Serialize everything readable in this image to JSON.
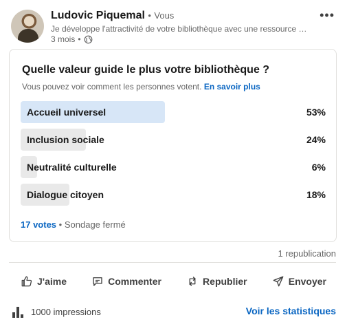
{
  "author": {
    "name": "Ludovic Piquemal",
    "separator": "•",
    "relation": "Vous",
    "headline": "Je développe l'attractivité de votre bibliothèque avec une ressource …",
    "time": "3 mois",
    "time_separator": "•",
    "visibility_icon": "globe-icon"
  },
  "menu_icon": "more-horizontal-icon",
  "poll": {
    "question": "Quelle valeur guide le plus votre bibliothèque ?",
    "visibility_text": "Vous pouvez voir comment les personnes votent.",
    "learn_more": "En savoir plus",
    "options": [
      {
        "label": "Accueil universel",
        "percent_text": "53%",
        "percent": 53,
        "selected": true
      },
      {
        "label": "Inclusion sociale",
        "percent_text": "24%",
        "percent": 24,
        "selected": false
      },
      {
        "label": "Neutralité culturelle",
        "percent_text": "6%",
        "percent": 6,
        "selected": false
      },
      {
        "label": "Dialogue citoyen",
        "percent_text": "18%",
        "percent": 18,
        "selected": false
      }
    ],
    "votes": "17 votes",
    "votes_separator": "•",
    "status": "Sondage fermé"
  },
  "social": {
    "reposts": "1 republication"
  },
  "actions": [
    {
      "label": "J'aime",
      "icon": "like-icon"
    },
    {
      "label": "Commenter",
      "icon": "comment-icon"
    },
    {
      "label": "Republier",
      "icon": "repost-icon"
    },
    {
      "label": "Envoyer",
      "icon": "send-icon"
    }
  ],
  "footer": {
    "impressions": "1000 impressions",
    "stats_link": "Voir les statistiques",
    "icon": "bar-chart-icon"
  },
  "colors": {
    "accent": "#0a66c2",
    "selected_bar": "#d7e6f7",
    "bar": "#e9e9e9"
  }
}
